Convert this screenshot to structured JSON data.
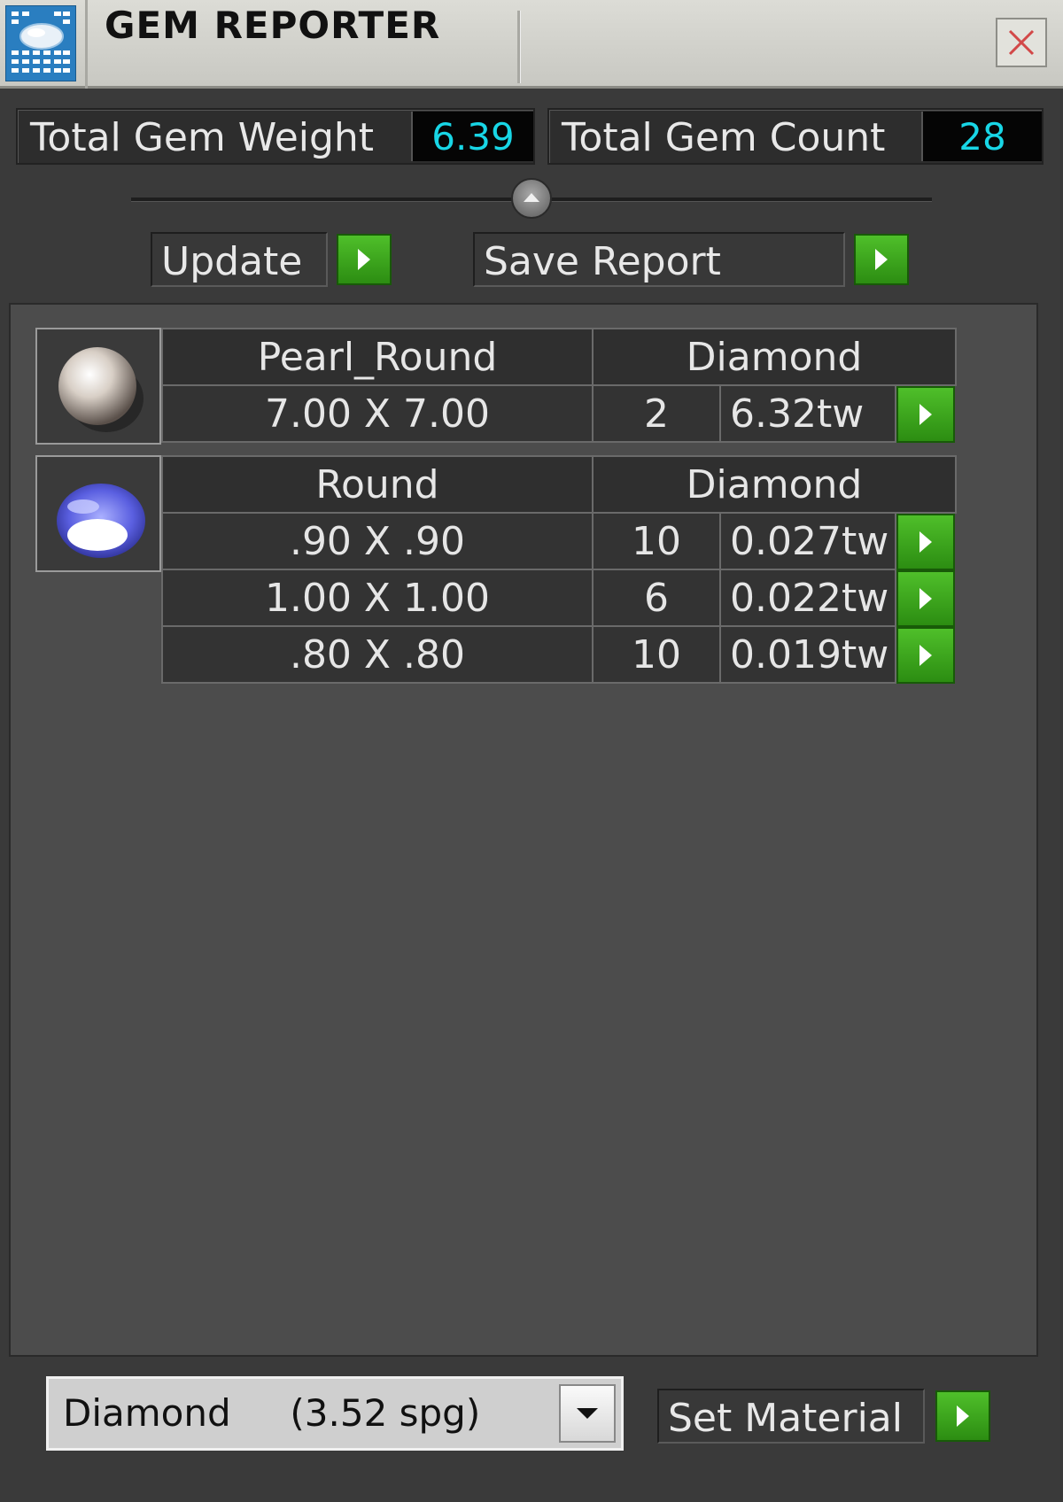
{
  "window": {
    "title": "GEM REPORTER",
    "icon": "gem-reporter-app-icon",
    "close_icon": "close-icon"
  },
  "totals": {
    "weight_label": "Total Gem Weight",
    "weight_value": "6.39",
    "count_label": "Total Gem Count",
    "count_value": "28",
    "value_color": "#18d6e6"
  },
  "actions": {
    "update_label": "Update",
    "save_label": "Save Report"
  },
  "groups": [
    {
      "shape": "Pearl_Round",
      "material": "Diamond",
      "icon": "pearl-icon",
      "rows": [
        {
          "size": "7.00 X 7.00",
          "count": "2",
          "weight": "6.32tw"
        }
      ]
    },
    {
      "shape": "Round",
      "material": "Diamond",
      "icon": "round-gem-icon",
      "rows": [
        {
          "size": ".90 X .90",
          "count": "10",
          "weight": "0.027tw"
        },
        {
          "size": "1.00 X 1.00",
          "count": "6",
          "weight": "0.022tw"
        },
        {
          "size": ".80 X .80",
          "count": "10",
          "weight": "0.019tw"
        }
      ]
    }
  ],
  "material": {
    "selected": "Diamond     (3.52 spg)",
    "set_label": "Set Material"
  },
  "colors": {
    "go_button": "#3aa81e",
    "panel": "#4c4c4c",
    "titlebar": "#d4d4ce"
  }
}
